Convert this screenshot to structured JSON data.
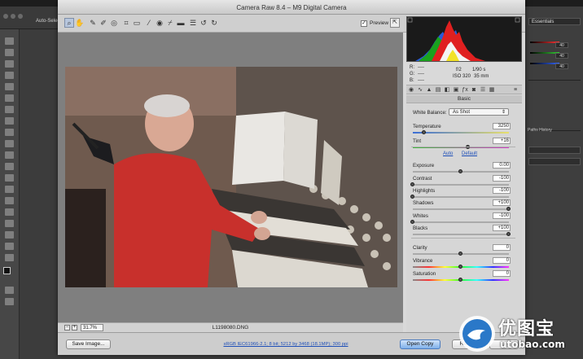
{
  "window": {
    "title": "Camera Raw 8.4  –  M9 Digital Camera"
  },
  "ps": {
    "options_label": "Auto-Select",
    "workspace": "Essentials",
    "side_values": [
      "40",
      "40",
      "40"
    ],
    "panel_tabs": "Paths  History"
  },
  "toolbar": {
    "preview_label": "Preview",
    "preview_checked": "✓"
  },
  "image": {
    "zoom": "31.7%",
    "filename": "L1198080.DNG"
  },
  "camera_info": {
    "r": "R:",
    "g": "G:",
    "b": "B:",
    "dash": "----",
    "aperture": "f/2",
    "shutter": "1/90 s",
    "iso": "ISO 320",
    "focal": "35 mm"
  },
  "panel": {
    "title": "Basic"
  },
  "white_balance": {
    "label": "White Balance:",
    "value": "As Shot"
  },
  "links": {
    "auto": "Auto",
    "default": "Default"
  },
  "sliders": [
    {
      "id": "temperature",
      "label": "Temperature",
      "value": "3250",
      "pos": 0.12
    },
    {
      "id": "tint",
      "label": "Tint",
      "value": "+16",
      "pos": 0.58
    },
    {
      "id": "exposure",
      "label": "Exposure",
      "value": "0.00",
      "pos": 0.5
    },
    {
      "id": "contrast",
      "label": "Contrast",
      "value": "-100",
      "pos": 0.0
    },
    {
      "id": "highlights",
      "label": "Highlights",
      "value": "-100",
      "pos": 0.0
    },
    {
      "id": "shadows",
      "label": "Shadows",
      "value": "+100",
      "pos": 1.0
    },
    {
      "id": "whites",
      "label": "Whites",
      "value": "-100",
      "pos": 0.0
    },
    {
      "id": "blacks",
      "label": "Blacks",
      "value": "+100",
      "pos": 1.0
    },
    {
      "id": "clarity",
      "label": "Clarity",
      "value": "0",
      "pos": 0.5
    },
    {
      "id": "vibrance",
      "label": "Vibrance",
      "value": "0",
      "pos": 0.5
    },
    {
      "id": "saturation",
      "label": "Saturation",
      "value": "0",
      "pos": 0.5
    }
  ],
  "footer": {
    "save_label": "Save Image...",
    "workflow": "sRGB IEC61966-2.1; 8 bit; 5212 by 3468 (18.1MP); 300 ppi",
    "open_label": "Open Copy",
    "reset_label": "Reset"
  },
  "watermark": {
    "brand": "优图宝",
    "domain": "utobao.com"
  },
  "colors": {
    "accent": "#2a78c8",
    "window_bg": "#d9d9d9",
    "image_bg": "#7f7f7f",
    "red_jacket": "#c8302c"
  }
}
